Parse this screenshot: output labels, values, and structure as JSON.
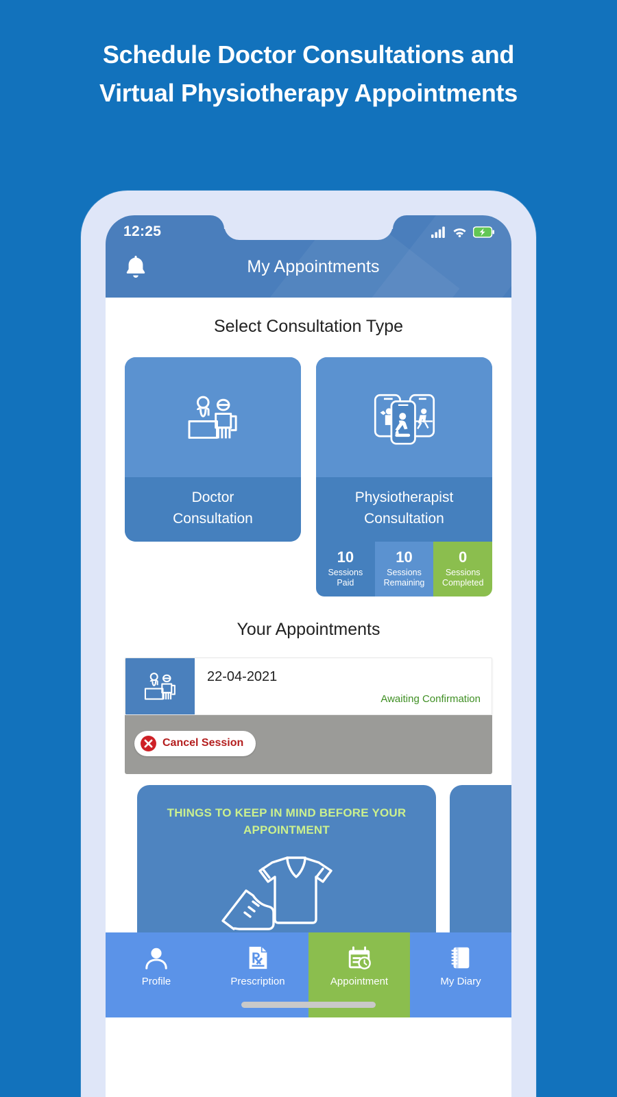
{
  "headline": "Schedule Doctor Consultations and Virtual Physiotherapy Appointments",
  "colors": {
    "background": "#1272BC",
    "phone_frame": "#DFE6F8",
    "header_blue": "#4A7EBC",
    "card_blue_light": "#5B92D0",
    "card_blue_dark": "#4580BE",
    "accent_green": "#8BBE4E",
    "status_green": "#3F8F23",
    "cancel_red": "#B41E1E",
    "gray_bar": "#9B9B98",
    "tip_title_green": "#CBF08E",
    "nav_blue": "#5B93E8"
  },
  "status_bar": {
    "time": "12:25",
    "signal_icon": "signal-bars-icon",
    "wifi_icon": "wifi-icon",
    "battery_icon": "battery-charging-icon"
  },
  "header": {
    "bell_icon": "bell-icon",
    "title": "My Appointments"
  },
  "consultation": {
    "section_title": "Select Consultation Type",
    "cards": [
      {
        "id": "doctor",
        "label": "Doctor\nConsultation",
        "icon": "doctor-desk-icon"
      },
      {
        "id": "physio",
        "label": "Physiotherapist\nConsultation",
        "icon": "phones-exercise-icon"
      }
    ],
    "stats": [
      {
        "value": "10",
        "label": "Sessions\nPaid",
        "color": "#4580BE"
      },
      {
        "value": "10",
        "label": "Sessions\nRemaining",
        "color": "#5B92D0"
      },
      {
        "value": "0",
        "label": "Sessions\nCompleted",
        "color": "#8BBE4E"
      }
    ]
  },
  "appointments": {
    "section_title": "Your Appointments",
    "items": [
      {
        "thumb_icon": "doctor-desk-icon",
        "date": "22-04-2021",
        "status": "Awaiting Confirmation",
        "cancel_label": "Cancel Session",
        "cancel_icon": "close-circle-icon"
      }
    ]
  },
  "tips": {
    "cards": [
      {
        "title": "THINGS TO KEEP IN MIND BEFORE YOUR APPOINTMENT",
        "icon": "tshirt-shoe-icon"
      },
      {
        "title": "",
        "icon": ""
      }
    ]
  },
  "bottom_nav": {
    "items": [
      {
        "label": "Profile",
        "icon": "person-icon",
        "active": false
      },
      {
        "label": "Prescription",
        "icon": "prescription-icon",
        "active": false
      },
      {
        "label": "Appointment",
        "icon": "calendar-clock-icon",
        "active": true
      },
      {
        "label": "My Diary",
        "icon": "notebook-icon",
        "active": false
      }
    ]
  }
}
